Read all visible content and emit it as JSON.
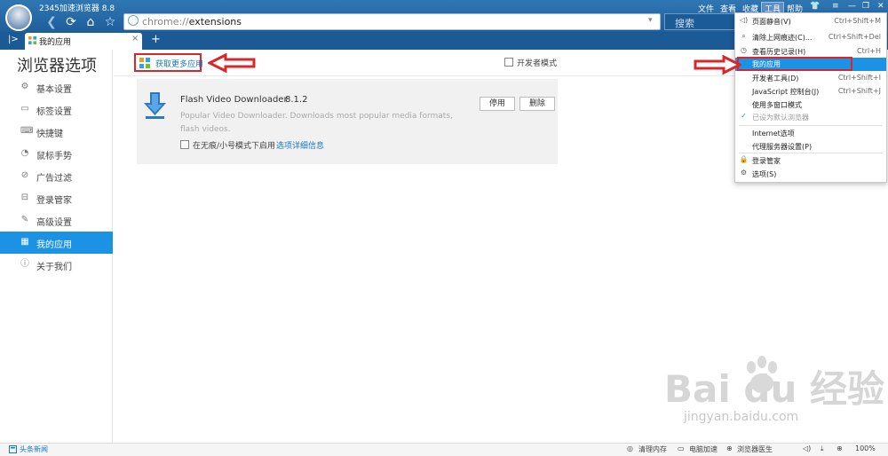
{
  "titlebar": {
    "app_title": "2345加速浏览器 8.8"
  },
  "menubar": {
    "file": "文件",
    "view": "查看",
    "bookmarks": "收藏",
    "tools": "工具",
    "help": "帮助"
  },
  "address": {
    "scheme": "chrome://",
    "host": "extensions",
    "search_placeholder": "搜索"
  },
  "tab": {
    "label": "我的应用",
    "close": "×",
    "new": "+"
  },
  "page": {
    "title": "浏览器选项",
    "get_more": "获取更多应用",
    "developer_mode": "开发者模式"
  },
  "nav": {
    "items": [
      {
        "label": "基本设置",
        "icon": "gear-icon"
      },
      {
        "label": "标签设置",
        "icon": "tab-icon"
      },
      {
        "label": "快捷键",
        "icon": "keyboard-icon"
      },
      {
        "label": "鼠标手势",
        "icon": "mouse-icon"
      },
      {
        "label": "广告过滤",
        "icon": "filter-icon"
      },
      {
        "label": "登录管家",
        "icon": "login-icon"
      },
      {
        "label": "高级设置",
        "icon": "wrench-icon"
      },
      {
        "label": "我的应用",
        "icon": "apps-icon"
      },
      {
        "label": "关于我们",
        "icon": "info-icon"
      }
    ],
    "active": "我的应用"
  },
  "extension": {
    "name": "Flash Video Downloader",
    "version": "8.1.2",
    "description": "Popular Video Downloader. Downloads most popular media formats, flash videos.",
    "disable": "停用",
    "remove": "删除",
    "incognito": "在无痕/小号模式下启用",
    "options": "选项",
    "details": "详细信息"
  },
  "tools_menu": [
    {
      "label": "页面静音(V)",
      "shortcut": "Ctrl+Shift+M",
      "icon": "speaker-icon"
    },
    {
      "label": "清除上网痕迹(C)...",
      "shortcut": "Ctrl+Shift+Del",
      "icon": "broom-icon"
    },
    {
      "label": "查看历史记录(H)",
      "shortcut": "Ctrl+H",
      "icon": "clock-icon"
    },
    {
      "label": "我的应用",
      "shortcut": "",
      "icon": ""
    },
    {
      "label": "开发者工具(D)",
      "shortcut": "Ctrl+Shift+I",
      "icon": ""
    },
    {
      "label": "JavaScript 控制台(J)",
      "shortcut": "Ctrl+Shift+J",
      "icon": ""
    },
    {
      "label": "使用多窗口模式",
      "shortcut": "",
      "icon": ""
    },
    {
      "label": "已设为默认浏览器",
      "shortcut": "",
      "icon": "check-icon"
    },
    {
      "label": "Internet选项",
      "shortcut": "",
      "icon": ""
    },
    {
      "label": "代理服务器设置(P)",
      "shortcut": "",
      "icon": ""
    },
    {
      "label": "登录管家",
      "shortcut": "",
      "icon": "lock-icon"
    },
    {
      "label": "选项(S)",
      "shortcut": "",
      "icon": "gear-icon"
    }
  ],
  "statusbar": {
    "news": "头条新闻",
    "clean_mem": "清理内存",
    "speedup": "电脑加速",
    "doctor": "浏览器医生",
    "zoom": "100%"
  },
  "watermark": {
    "main": "Bai du 经验",
    "sub": "jingyan.baidu.com"
  },
  "colors": {
    "accent": "#1c92e4",
    "titlebar": "#2f77b4",
    "annotation": "#d8262a",
    "link": "#1878c8"
  }
}
